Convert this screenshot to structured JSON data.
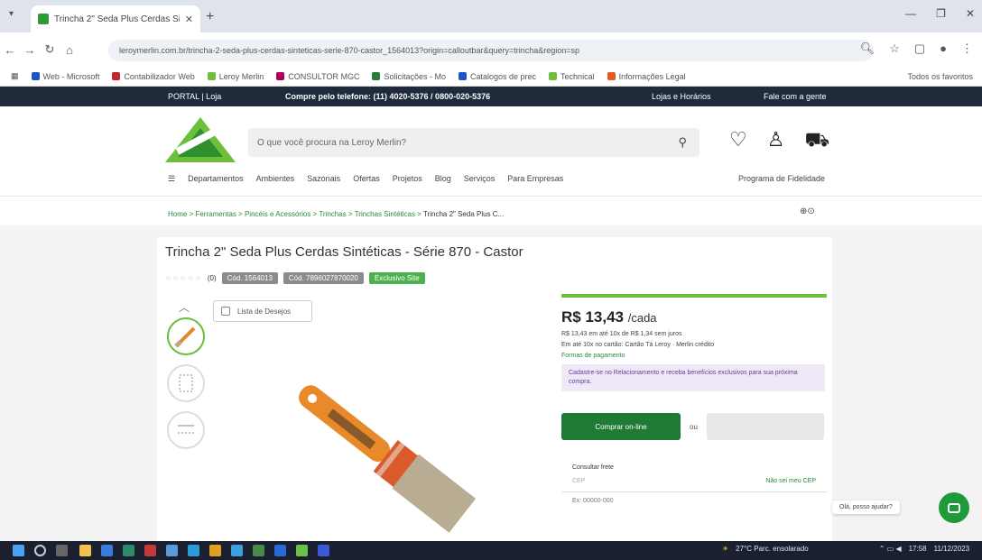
{
  "browser": {
    "tab_title": "Trincha 2\" Seda Plus Cerdas Si...",
    "url": "leroymerlin.com.br/trincha-2-seda-plus-cerdas-sinteticas-serie-870-castor_1564013?origin=calloutbar&query=trincha&region=sp",
    "new_tab": "+",
    "bookmarks": [
      {
        "label": "Web - Microsoft",
        "color": "#1a56c4"
      },
      {
        "label": "Contabilizador Web",
        "color": "#c4262e"
      },
      {
        "label": "Leroy Merlin",
        "color": "#6cbf3a"
      },
      {
        "label": "CONSULTOR MGC",
        "color": "#b0005a"
      },
      {
        "label": "Solicitações - Mo",
        "color": "#2a7a3a"
      },
      {
        "label": "Catalogos de prec",
        "color": "#1a56c4"
      },
      {
        "label": "Technical",
        "color": "#6cbf3a"
      },
      {
        "label": "Informações Legal",
        "color": "#e25a1e"
      }
    ],
    "bookmarks_right": "Todos os favoritos"
  },
  "topstrip": {
    "left": "PORTAL | Loja",
    "center": "Compre pelo telefone: (11) 4020-5376 / 0800-020-5376",
    "r1": "Lojas e Horários",
    "r2": "Fale com a gente"
  },
  "header": {
    "search_placeholder": "O que você procura na Leroy Merlin?",
    "menu": [
      "Departamentos",
      "Ambientes",
      "Sazonais",
      "Ofertas",
      "Projetos",
      "Blog",
      "Serviços",
      "Para Empresas"
    ],
    "menu_right": "Programa de Fidelidade"
  },
  "breadcrumb": {
    "path": [
      "Home",
      "Ferramentas",
      "Pincéis e Acessórios",
      "Trinchas",
      "Trinchas Sintéticas",
      "Trincha 2\" Seda Plus C..."
    ]
  },
  "product": {
    "title": "Trincha 2\" Seda Plus Cerdas Sintéticas - Série 870 - Castor",
    "stars": "☆☆☆☆☆",
    "rating_count": "(0)",
    "tags": [
      "Cód. 1564013",
      "Cód. 7896027870020",
      "Exclusivo Site"
    ],
    "list_button": "Lista de Desejos",
    "price_label": "R$ 13,43",
    "price_unit": "/cada",
    "line1": "R$ 13,43 em até 10x de R$ 1,34 sem juros",
    "line2": "Em até 10x no cartão: Cartão Tá Leroy · Merlin crédito",
    "payment_link": "Formas de pagamento",
    "promo_text": "Cadastre-se no Relacionamento e receba benefícios exclusivos para sua próxima compra.",
    "buy_button": "Comprar on-line",
    "or_text": "ou",
    "shipping_label": "Consultar frete",
    "cep_placeholder": "CEP",
    "cep_link": "Não sei meu CEP",
    "shipping_foot": "Ex: 00000-000"
  },
  "chat": {
    "label": "Olá, posso ajudar?"
  },
  "taskbar": {
    "tray_text": "27°C Parc. ensolarado",
    "time": "17:58",
    "date": "11/12/2023"
  }
}
